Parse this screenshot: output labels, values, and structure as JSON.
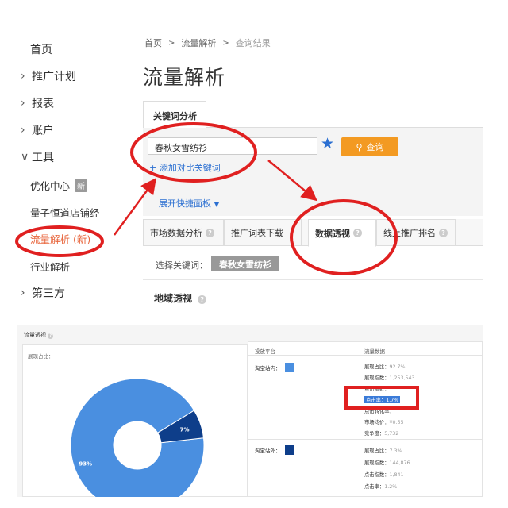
{
  "sidebar": {
    "items": [
      {
        "label": "首页",
        "chevron": ""
      },
      {
        "label": "推广计划",
        "chevron": "›"
      },
      {
        "label": "报表",
        "chevron": "›"
      },
      {
        "label": "账户",
        "chevron": "›"
      },
      {
        "label": "工具",
        "chevron": "∨"
      }
    ],
    "sub_items": [
      {
        "label": "优化中心",
        "badge": "新"
      },
      {
        "label": "量子恒道店铺经"
      },
      {
        "label": "流量解析 (新)",
        "active": true
      },
      {
        "label": "行业解析"
      }
    ],
    "third_party": {
      "label": "第三方",
      "chevron": "›"
    }
  },
  "breadcrumb": {
    "home": "首页",
    "sep": ">",
    "section": "流量解析",
    "current": "查询结果"
  },
  "page_title": "流量解析",
  "keyword_tab": "关键词分析",
  "keyword_input": {
    "value": "春秋女雪纺衫"
  },
  "query_button": "查询",
  "add_compare": "+ 添加对比关键词",
  "expand_panel": "展开快捷面板",
  "tabs": [
    {
      "label": "市场数据分析"
    },
    {
      "label": "推广词表下载"
    },
    {
      "label": "数据透视",
      "active": true
    },
    {
      "label": "线上推广排名"
    }
  ],
  "select_keyword": {
    "label": "选择关键词：",
    "value": "春秋女雪纺衫"
  },
  "region_title": "地域透视",
  "bottom": {
    "title": "流量透视",
    "share_label": "展现占比：",
    "col_platform": "投放平台",
    "col_data": "流量数据",
    "platforms": [
      {
        "name": "淘宝站内：",
        "color": "#4a8fe0"
      },
      {
        "name": "淘宝站外：",
        "color": "#0e3e8a"
      }
    ],
    "inside_metrics": [
      {
        "label": "展现占比：",
        "value": "92.7%"
      },
      {
        "label": "展现指数：",
        "value": "1,253,543"
      },
      {
        "label": "点击指数：",
        "value": ""
      },
      {
        "label": "点击率：",
        "value": "1.7%",
        "highlight": true
      },
      {
        "label": "点击转化率：",
        "value": ""
      },
      {
        "label": "市场均价：",
        "value": "¥0.55"
      },
      {
        "label": "竞争度：",
        "value": "5,732"
      }
    ],
    "outside_metrics": [
      {
        "label": "展现占比：",
        "value": "7.3%"
      },
      {
        "label": "展现指数：",
        "value": "144,876"
      },
      {
        "label": "点击指数：",
        "value": "1,841"
      },
      {
        "label": "点击率：",
        "value": "1.2%"
      }
    ]
  },
  "chart_data": {
    "type": "pie",
    "title": "",
    "categories": [
      "淘宝站内",
      "淘宝站外"
    ],
    "values": [
      93,
      7
    ],
    "labels": [
      "93%",
      "7%"
    ],
    "colors": [
      "#4a8fe0",
      "#0e3e8a"
    ],
    "donut": true
  }
}
